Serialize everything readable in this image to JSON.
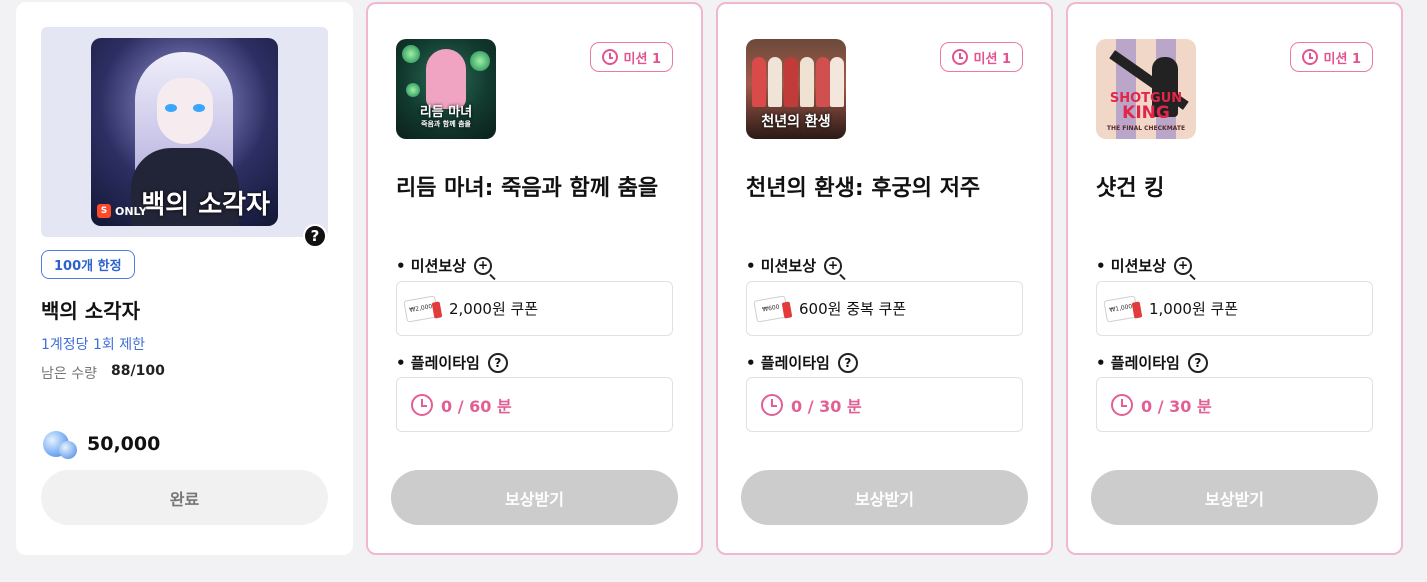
{
  "product": {
    "artwork_title": "백의 소각자",
    "artwork_subtitle": "백의",
    "artwork_badge_letter": "S",
    "artwork_badge_text": "ONLY",
    "help_symbol": "?",
    "limit_badge": "100개 한정",
    "title": "백의 소각자",
    "per_account": "1계정당 1회 제한",
    "remaining_label": "남은 수량",
    "remaining_value": "88/100",
    "price": "50,000",
    "price_icon": "gem-icon",
    "button_label": "완료"
  },
  "missions": [
    {
      "badge": "미션 1",
      "title": "리듬 마녀: 죽음과 함께 춤을",
      "thumb_text_1": "리듬 마녀",
      "thumb_text_2": "죽음과 함께 춤을",
      "reward_label": "• 미션보상",
      "reward_text": "2,000원 쿠폰",
      "coupon_text": "₩2,000",
      "playtime_label": "• 플레이타임",
      "playtime_value": "0 / 60 분",
      "button_label": "보상받기"
    },
    {
      "badge": "미션 1",
      "title": "천년의 환생: 후궁의 저주",
      "thumb_text_1": "천년의 환생",
      "thumb_text_2": "",
      "reward_label": "• 미션보상",
      "reward_text": "600원 중복 쿠폰",
      "coupon_text": "₩600",
      "playtime_label": "• 플레이타임",
      "playtime_value": "0 / 30 분",
      "button_label": "보상받기"
    },
    {
      "badge": "미션 1",
      "title": "샷건 킹",
      "thumb_text_1": "SHOTGUN",
      "thumb_text_2": "KING",
      "thumb_text_3": "THE FINAL CHECKMATE",
      "reward_label": "• 미션보상",
      "reward_text": "1,000원 쿠폰",
      "coupon_text": "₩1,000",
      "playtime_label": "• 플레이타임",
      "playtime_value": "0 / 30 분",
      "button_label": "보상받기"
    }
  ],
  "icons": {
    "zoom": "+",
    "question": "?"
  },
  "colors": {
    "accent_pink": "#e2548f",
    "link_blue": "#3f6fd6",
    "disabled_button": "#cccccc",
    "card_border_pink": "#f1b7cf"
  }
}
